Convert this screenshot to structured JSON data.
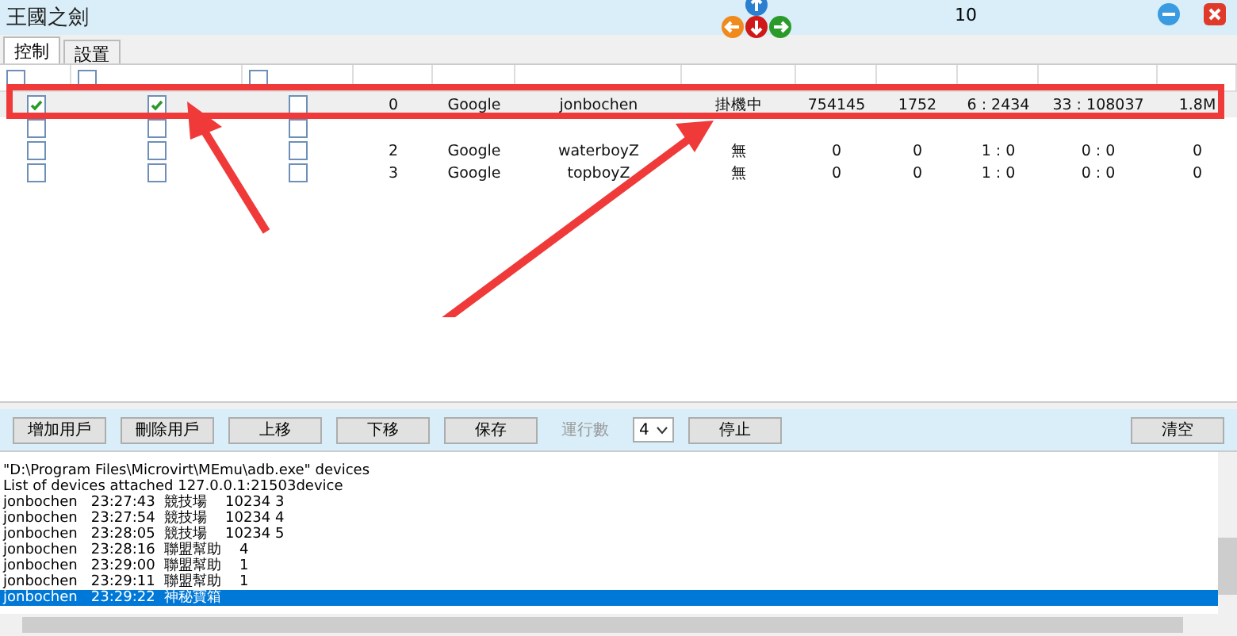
{
  "window": {
    "title": "王國之劍",
    "counter": "10"
  },
  "tabs": [
    {
      "label": "控制",
      "selected": true
    },
    {
      "label": "設置",
      "selected": false
    }
  ],
  "table": {
    "header_checkboxes": [
      {
        "checked": false
      },
      {
        "checked": false
      },
      {
        "checked": false
      }
    ],
    "rows": [
      {
        "selected": true,
        "run": true,
        "close": true,
        "hide": false,
        "cells": [
          "0",
          "Google",
          "jonbochen",
          "掛機中",
          "754145",
          "1752",
          "6 : 2434",
          "33 : 108037",
          "1.8M"
        ]
      },
      {
        "selected": false,
        "run": false,
        "close": false,
        "hide": false
      },
      {
        "selected": false,
        "run": false,
        "close": false,
        "hide": false,
        "cells": [
          "2",
          "Google",
          "waterboyZ",
          "無",
          "0",
          "0",
          "1 : 0",
          "0 : 0",
          "0"
        ]
      },
      {
        "selected": false,
        "run": false,
        "close": false,
        "hide": false,
        "cells": [
          "3",
          "Google",
          "topboyZ",
          "無",
          "0",
          "0",
          "1 : 0",
          "0 : 0",
          "0"
        ]
      }
    ]
  },
  "toolbar": {
    "buttons": [
      "增加用戶",
      "刪除用戶",
      "上移",
      "下移",
      "保存"
    ],
    "count_label": "運行數",
    "count_value": "4",
    "stop": "停止",
    "clear": "清空"
  },
  "log": [
    {
      "text": "\"D:\\Program Files\\Microvirt\\MEmu\\adb.exe\" devices",
      "selected": false
    },
    {
      "text": "List of devices attached 127.0.0.1:21503device",
      "selected": false
    },
    {
      "text": "jonbochen   23:27:43  競技場    10234 3",
      "selected": false
    },
    {
      "text": "jonbochen   23:27:54  競技場    10234 4",
      "selected": false
    },
    {
      "text": "jonbochen   23:28:05  競技場    10234 5",
      "selected": false
    },
    {
      "text": "jonbochen   23:28:16  聯盟幫助    4",
      "selected": false
    },
    {
      "text": "jonbochen   23:29:00  聯盟幫助    1",
      "selected": false
    },
    {
      "text": "jonbochen   23:29:11  聯盟幫助    1",
      "selected": false
    },
    {
      "text": "jonbochen   23:29:22  神秘寶箱",
      "selected": true
    }
  ]
}
